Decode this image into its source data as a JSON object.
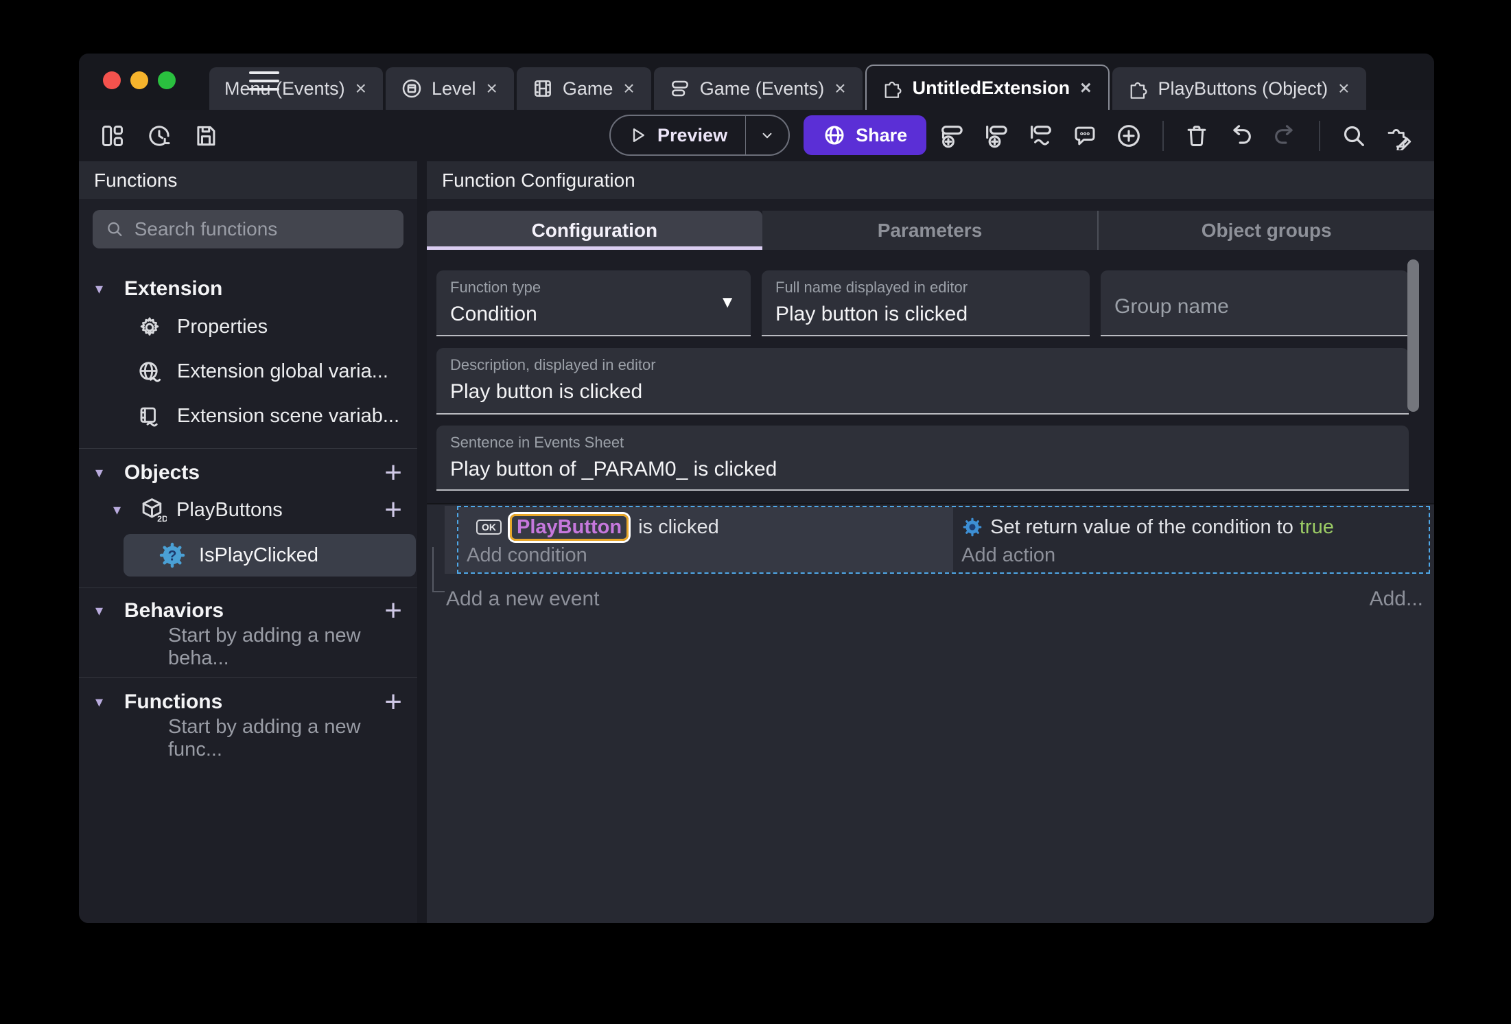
{
  "ui": {
    "close": "×"
  },
  "colors": {
    "accent_purple": "#5b2fd6",
    "tab_underline": "#dbcef2",
    "object_chip_text": "#c678dd",
    "object_chip_border": "#e8a72a",
    "true_green": "#9ccc65",
    "selection_blue": "#4fa8e8"
  },
  "titlebar": {
    "tabs": [
      {
        "label": "Menu (Events)",
        "icon": "none",
        "active": false
      },
      {
        "label": "Level",
        "icon": "scene-icon",
        "active": false
      },
      {
        "label": "Game",
        "icon": "film-icon",
        "active": false
      },
      {
        "label": "Game (Events)",
        "icon": "events-sheet-icon",
        "active": false
      },
      {
        "label": "UntitledExtension",
        "icon": "puzzle-icon",
        "active": true
      },
      {
        "label": "PlayButtons (Object)",
        "icon": "puzzle-icon",
        "active": false
      }
    ]
  },
  "toolbar": {
    "preview_label": "Preview",
    "share_label": "Share"
  },
  "sidebar": {
    "header": "Functions",
    "search_placeholder": "Search functions",
    "extension": {
      "label": "Extension",
      "items": [
        {
          "icon": "gear-icon",
          "label": "Properties"
        },
        {
          "icon": "globe-variable-icon",
          "label": "Extension global varia..."
        },
        {
          "icon": "scene-variable-icon",
          "label": "Extension scene variab..."
        }
      ]
    },
    "objects": {
      "label": "Objects",
      "object": {
        "label": "PlayButtons",
        "badge": "2D",
        "function": {
          "label": "IsPlayClicked",
          "selected": true
        }
      }
    },
    "behaviors": {
      "label": "Behaviors",
      "empty": "Start by adding a new beha..."
    },
    "functions": {
      "label": "Functions",
      "empty": "Start by adding a new func..."
    }
  },
  "main": {
    "header": "Function Configuration",
    "tabs": [
      {
        "label": "Configuration",
        "active": true
      },
      {
        "label": "Parameters",
        "active": false
      },
      {
        "label": "Object groups",
        "active": false
      }
    ],
    "form": {
      "function_type": {
        "label": "Function type",
        "value": "Condition"
      },
      "full_name": {
        "label": "Full name displayed in editor",
        "value": "Play button is clicked"
      },
      "group_name": {
        "placeholder": "Group name",
        "value": ""
      },
      "description": {
        "label": "Description, displayed in editor",
        "value": "Play button is clicked"
      },
      "sentence": {
        "label": "Sentence in Events Sheet",
        "value": "Play button of _PARAM0_ is clicked"
      }
    }
  },
  "events": {
    "condition": {
      "ok": "OK",
      "object": "PlayButton",
      "suffix": "is clicked",
      "add": "Add condition"
    },
    "action": {
      "prefix": "Set return value of the condition to",
      "value": "true",
      "add": "Add action"
    },
    "add_new": "Add a new event",
    "add_more": "Add..."
  }
}
